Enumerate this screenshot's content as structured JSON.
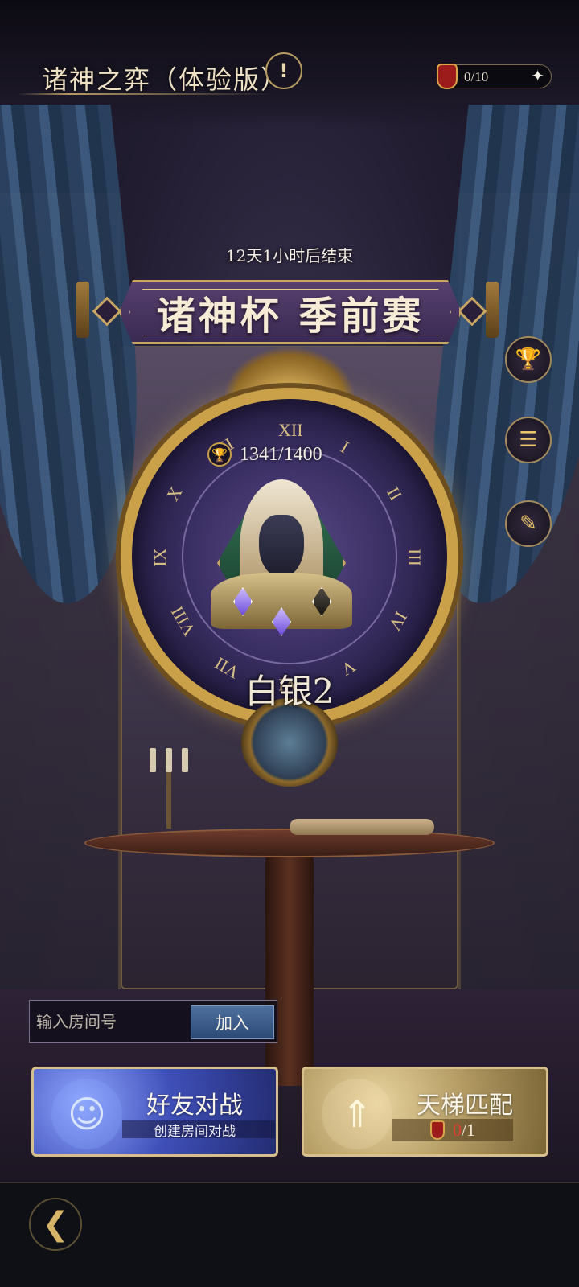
{
  "header": {
    "title": "诸神之弈（体验版）",
    "info_icon": "exclamation-icon",
    "tickets": {
      "count": "0/10",
      "icon": "red-ticket-icon",
      "add_icon": "sparkle-icon"
    }
  },
  "event": {
    "countdown": "12天1小时后结束",
    "title": "诸神杯 季前赛"
  },
  "rank": {
    "score": "1341/1400",
    "score_icon": "trophy-icon",
    "name": "白银2",
    "numerals": [
      "XII",
      "I",
      "II",
      "III",
      "IV",
      "V",
      "VI",
      "VII",
      "VIII",
      "IX",
      "X",
      "XI"
    ]
  },
  "side_menu": [
    {
      "icon": "trophy-button-icon",
      "glyph": "🏆"
    },
    {
      "icon": "list-document-icon",
      "glyph": "☰"
    },
    {
      "icon": "quill-book-icon",
      "glyph": "✎"
    }
  ],
  "room": {
    "placeholder": "输入房间号",
    "join_label": "加入"
  },
  "modes": {
    "friend": {
      "title": "好友对战",
      "subtitle": "创建房间对战",
      "icon": "friends-head-icon",
      "glyph": "☺"
    },
    "ladder": {
      "title": "天梯匹配",
      "count_used": "0",
      "count_total": "/1",
      "icon": "ladder-arrows-icon",
      "glyph": "⇑"
    }
  },
  "bottom": {
    "back_icon": "back-arrow-icon",
    "glyph": "❮"
  },
  "colors": {
    "gold": "#caa049",
    "accent_blue": "#3f4fb8",
    "ticket_red": "#9c1c1c",
    "zero_red": "#e33b2f"
  }
}
